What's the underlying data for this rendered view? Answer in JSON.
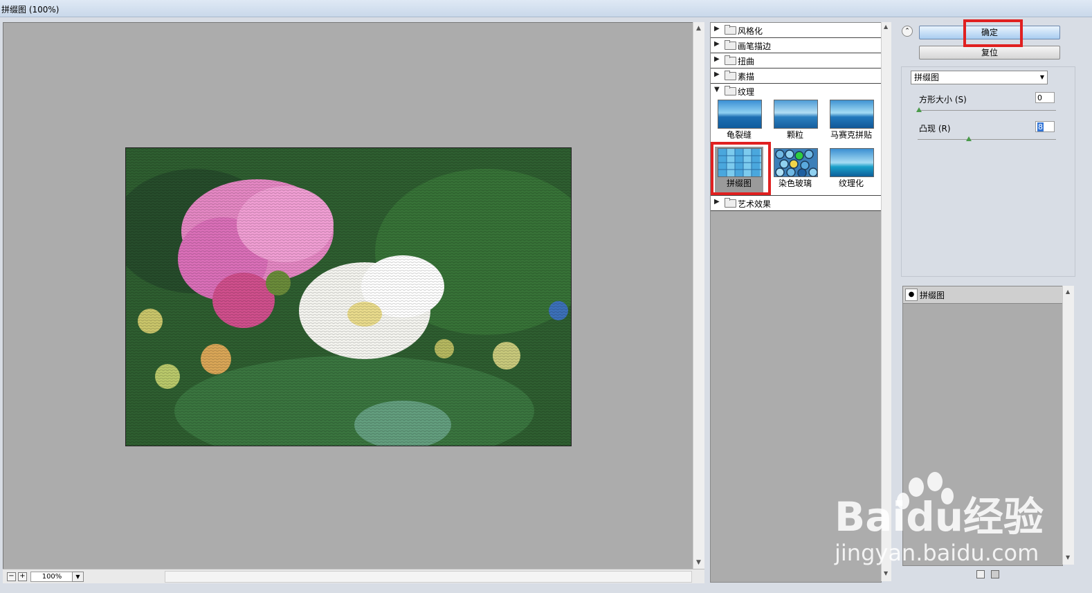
{
  "window": {
    "title": "拼缀图 (100%)"
  },
  "preview": {
    "zoom": "100%"
  },
  "filters": {
    "categories": [
      {
        "label": "风格化",
        "expanded": false
      },
      {
        "label": "画笔描边",
        "expanded": false
      },
      {
        "label": "扭曲",
        "expanded": false
      },
      {
        "label": "素描",
        "expanded": false
      },
      {
        "label": "纹理",
        "expanded": true
      },
      {
        "label": "艺术效果",
        "expanded": false
      }
    ],
    "texture_items": [
      {
        "label": "龟裂缝",
        "selected": false
      },
      {
        "label": "颗粒",
        "selected": false
      },
      {
        "label": "马赛克拼贴",
        "selected": false
      },
      {
        "label": "拼缀图",
        "selected": true
      },
      {
        "label": "染色玻璃",
        "selected": false
      },
      {
        "label": "纹理化",
        "selected": false
      }
    ]
  },
  "buttons": {
    "ok": "确定",
    "reset": "复位"
  },
  "params": {
    "filter_select": "拼缀图",
    "square_size": {
      "label": "方形大小 (S)",
      "value": "0"
    },
    "relief": {
      "label": "凸现 (R)",
      "value": "8"
    }
  },
  "layers": {
    "items": [
      {
        "name": "拼缀图"
      }
    ]
  },
  "watermark": {
    "brand": "Baidu经验",
    "url": "jingyan.baidu.com"
  },
  "colors": {
    "highlight_box": "#e02020",
    "ok_button": "#a9cdf0",
    "canvas": "#acacac"
  }
}
